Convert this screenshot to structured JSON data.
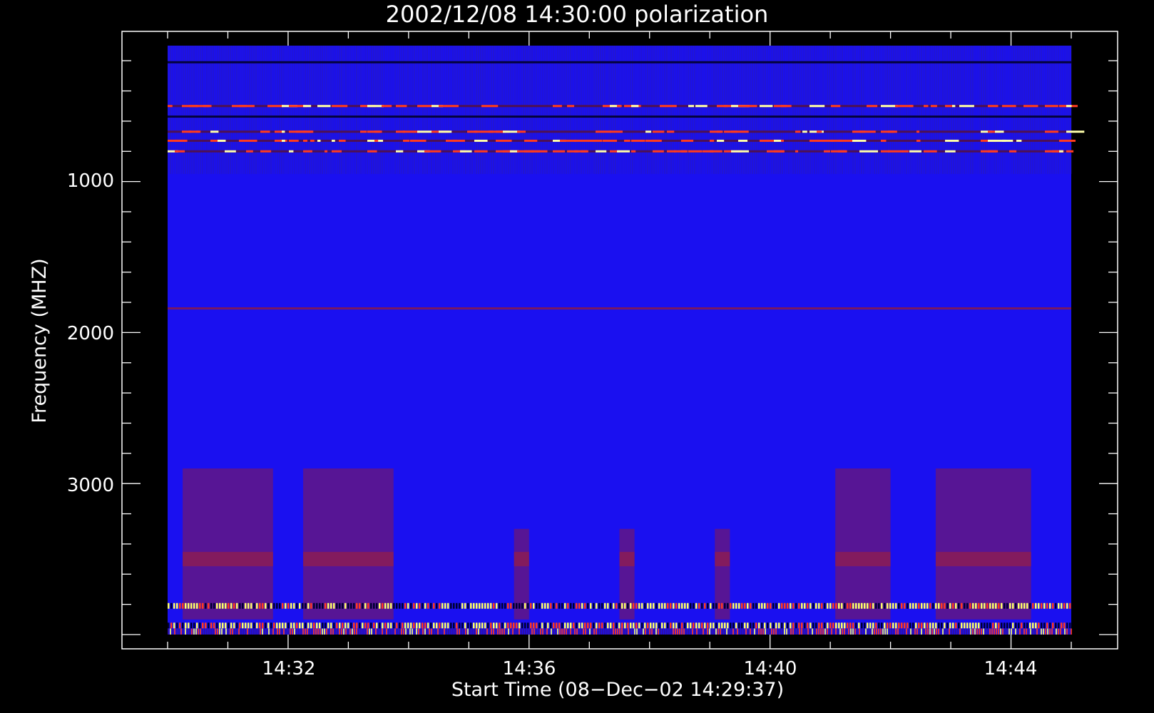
{
  "chart_data": {
    "type": "heatmap",
    "title": "2002/12/08 14:30:00 polarization",
    "xlabel": "Start Time (08−Dec−02 14:29:37)",
    "ylabel": "Frequency (MHZ)",
    "x_ticks": [
      "14:32",
      "14:36",
      "14:40",
      "14:44"
    ],
    "y_ticks": [
      "1000",
      "2000",
      "3000"
    ],
    "xlim": [
      "14:30:00",
      "14:45:00"
    ],
    "ylim": [
      100,
      4000
    ],
    "y_inverted": true,
    "grid": false,
    "colors": {
      "background": "#000000",
      "base": "#1a10f0",
      "enhanced": "#8a1a4a",
      "hot": "#ff3b1e",
      "saturated": "#ffff66"
    },
    "features": [
      {
        "kind": "rfi-band",
        "frequency": 210,
        "intensity": "dark"
      },
      {
        "kind": "rfi-band",
        "frequency": 500,
        "intensity": "hot"
      },
      {
        "kind": "rfi-band",
        "frequency": 570,
        "intensity": "dark"
      },
      {
        "kind": "rfi-band",
        "frequency": 670,
        "intensity": "hot"
      },
      {
        "kind": "rfi-band",
        "frequency": 730,
        "intensity": "hot"
      },
      {
        "kind": "rfi-band",
        "frequency": 800,
        "intensity": "hot"
      },
      {
        "kind": "rfi-band",
        "frequency": 1840,
        "intensity": "enhanced"
      },
      {
        "kind": "rfi-band",
        "frequency": 3810,
        "intensity": "saturated"
      },
      {
        "kind": "rfi-band",
        "frequency": 3940,
        "intensity": "saturated"
      },
      {
        "kind": "enhancement",
        "time_start": "14:30:15",
        "time_end": "14:31:45",
        "freq_start": 2900,
        "freq_end": 3900
      },
      {
        "kind": "enhancement",
        "time_start": "14:32:15",
        "time_end": "14:33:45",
        "freq_start": 2900,
        "freq_end": 3900
      },
      {
        "kind": "enhancement",
        "time_start": "14:41:05",
        "time_end": "14:42:00",
        "freq_start": 2900,
        "freq_end": 3900
      },
      {
        "kind": "enhancement",
        "time_start": "14:42:45",
        "time_end": "14:44:20",
        "freq_start": 2900,
        "freq_end": 3900
      },
      {
        "kind": "enhancement",
        "time_start": "14:35:45",
        "time_end": "14:36:00",
        "freq_start": 3300,
        "freq_end": 3900
      },
      {
        "kind": "enhancement",
        "time_start": "14:37:30",
        "time_end": "14:37:45",
        "freq_start": 3300,
        "freq_end": 3900
      },
      {
        "kind": "enhancement",
        "time_start": "14:39:05",
        "time_end": "14:39:20",
        "freq_start": 3300,
        "freq_end": 3900
      }
    ]
  }
}
